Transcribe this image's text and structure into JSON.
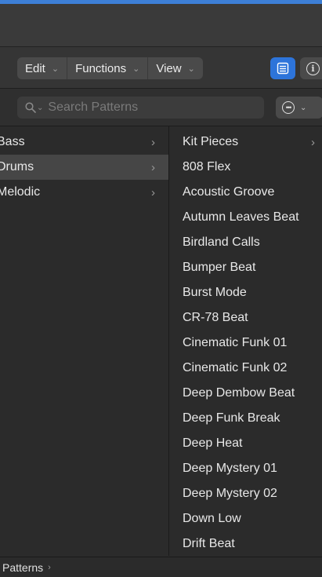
{
  "toolbar": {
    "menus": [
      {
        "label": "Edit"
      },
      {
        "label": "Functions"
      },
      {
        "label": "View"
      }
    ],
    "view_icon": "list-view-icon",
    "info_icon": "info-icon",
    "accent_color": "#2d74da"
  },
  "search": {
    "placeholder": "Search Patterns",
    "icon": "search-icon",
    "action_icon": "ellipsis-icon"
  },
  "categories": [
    {
      "label": "Bass",
      "selected": false
    },
    {
      "label": "Drums",
      "selected": true
    },
    {
      "label": "Melodic",
      "selected": false
    }
  ],
  "patterns": [
    {
      "label": "Kit Pieces",
      "has_children": true
    },
    {
      "label": "808 Flex"
    },
    {
      "label": "Acoustic Groove"
    },
    {
      "label": "Autumn Leaves Beat"
    },
    {
      "label": "Birdland Calls"
    },
    {
      "label": "Bumper Beat"
    },
    {
      "label": "Burst Mode"
    },
    {
      "label": "CR-78 Beat"
    },
    {
      "label": "Cinematic Funk 01"
    },
    {
      "label": "Cinematic Funk 02"
    },
    {
      "label": "Deep Dembow Beat"
    },
    {
      "label": "Deep Funk Break"
    },
    {
      "label": "Deep Heat"
    },
    {
      "label": "Deep Mystery 01"
    },
    {
      "label": "Deep Mystery 02"
    },
    {
      "label": "Down Low"
    },
    {
      "label": "Drift Beat"
    }
  ],
  "statusbar": {
    "path": "Patterns"
  }
}
